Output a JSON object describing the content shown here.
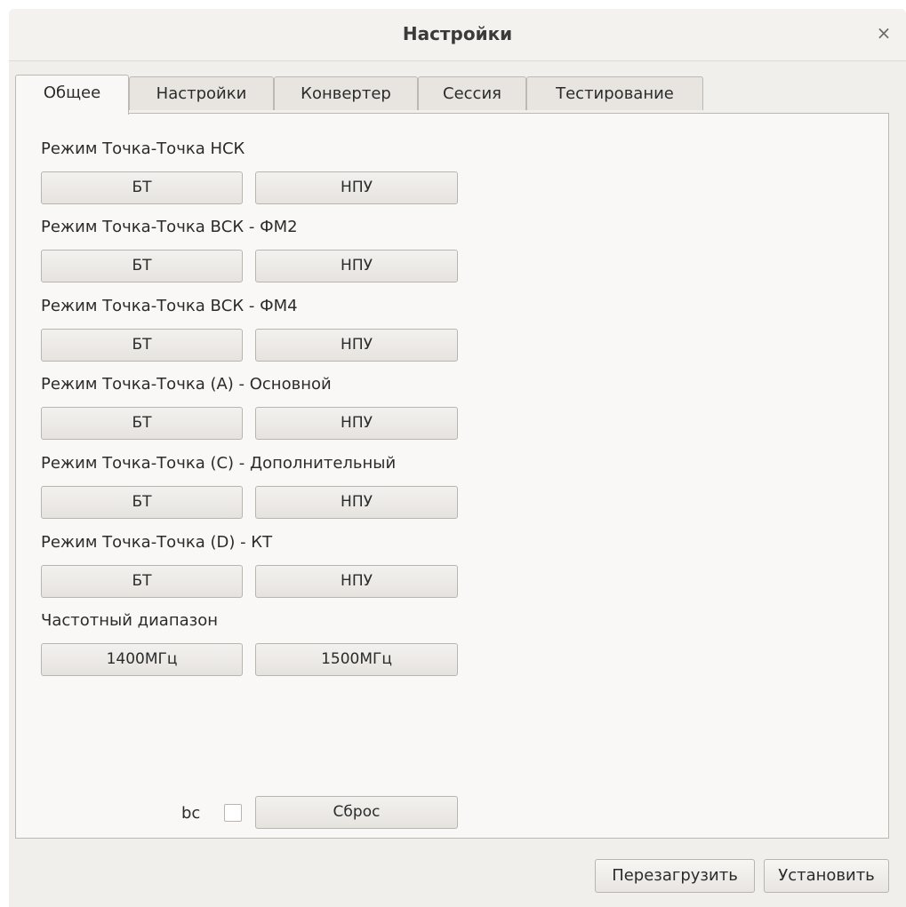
{
  "window": {
    "title": "Настройки",
    "close_glyph": "×"
  },
  "tabs": [
    {
      "label": "Общее",
      "active": true
    },
    {
      "label": "Настройки",
      "active": false
    },
    {
      "label": "Конвертер",
      "active": false
    },
    {
      "label": "Сессия",
      "active": false
    },
    {
      "label": "Тестирование",
      "active": false
    }
  ],
  "sections": [
    {
      "label": "Режим Точка-Точка НСК",
      "left_button": "БТ",
      "right_button": "НПУ"
    },
    {
      "label": "Режим Точка-Точка ВСК - ФМ2",
      "left_button": "БТ",
      "right_button": "НПУ"
    },
    {
      "label": "Режим Точка-Точка ВСК - ФМ4",
      "left_button": "БТ",
      "right_button": "НПУ"
    },
    {
      "label": "Режим Точка-Точка (А) - Основной",
      "left_button": "БТ",
      "right_button": "НПУ"
    },
    {
      "label": "Режим Точка-Точка (С) - Дополнительный",
      "left_button": "БТ",
      "right_button": "НПУ"
    },
    {
      "label": "Режим Точка-Точка (D) - КТ",
      "left_button": "БТ",
      "right_button": "НПУ"
    },
    {
      "label": "Частотный диапазон",
      "left_button": "1400МГц",
      "right_button": "1500МГц"
    }
  ],
  "bottom": {
    "bc_label": "bc",
    "bc_checked": false,
    "reset_label": "Сброс"
  },
  "footer": {
    "reboot_label": "Перезагрузить",
    "apply_label": "Установить"
  }
}
